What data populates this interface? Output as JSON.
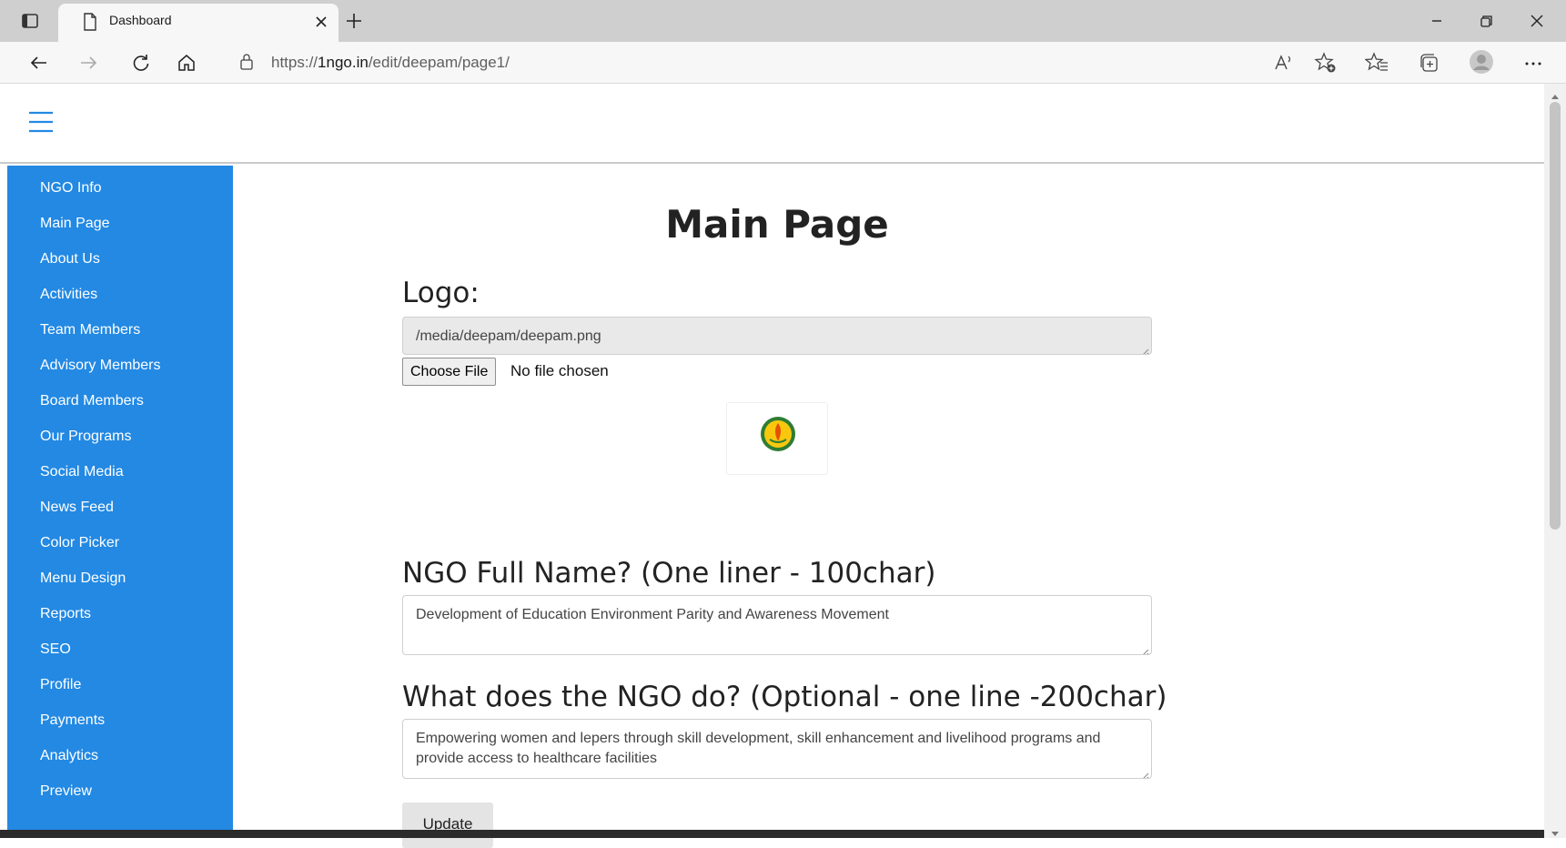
{
  "browser": {
    "tab_title": "Dashboard",
    "url_prefix": "https://",
    "url_host": "1ngo.in",
    "url_path": "/edit/deepam/page1/"
  },
  "sidebar": {
    "items": [
      {
        "label": "NGO Info"
      },
      {
        "label": "Main Page"
      },
      {
        "label": "About Us"
      },
      {
        "label": "Activities"
      },
      {
        "label": "Team Members"
      },
      {
        "label": "Advisory Members"
      },
      {
        "label": "Board Members"
      },
      {
        "label": "Our Programs"
      },
      {
        "label": "Social Media"
      },
      {
        "label": "News Feed"
      },
      {
        "label": "Color Picker"
      },
      {
        "label": "Menu Design"
      },
      {
        "label": "Reports"
      },
      {
        "label": "SEO"
      },
      {
        "label": "Profile"
      },
      {
        "label": "Payments"
      },
      {
        "label": "Analytics"
      },
      {
        "label": "Preview"
      }
    ]
  },
  "main": {
    "title": "Main Page",
    "logo": {
      "label": "Logo:",
      "value": "/media/deepam/deepam.png",
      "choose_button": "Choose File",
      "file_status": "No file chosen"
    },
    "full_name": {
      "label": "NGO Full Name? (One liner - 100char)",
      "value": "Development of Education Environment Parity and Awareness Movement"
    },
    "what_do": {
      "label": "What does the NGO do? (Optional - one line -200char)",
      "value": "Empowering women and lepers through skill development, skill enhancement and livelihood programs and provide access to healthcare facilities"
    },
    "update_button": "Update"
  },
  "colors": {
    "sidebar": "#2389e3",
    "accent": "#2389e3"
  }
}
